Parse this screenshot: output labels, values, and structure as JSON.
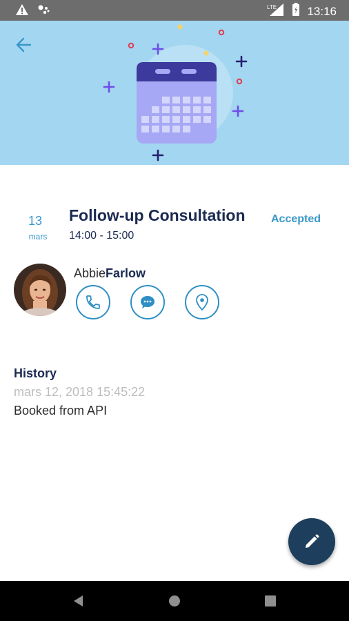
{
  "status_bar": {
    "time": "13:16",
    "network": "LTE",
    "icons": [
      "warning-icon",
      "assistant-icon",
      "signal-icon",
      "battery-icon"
    ]
  },
  "header": {
    "back_icon": "arrow-left-icon",
    "illustration": "calendar-icon",
    "background_color": "#a3d6f0"
  },
  "appointment": {
    "day": "13",
    "month": "mars",
    "title": "Follow-up Consultation",
    "time_range": "14:00 - 15:00",
    "status": "Accepted"
  },
  "client": {
    "first_name": "Abbie",
    "last_name": "Farlow",
    "actions": [
      "phone-icon",
      "chat-icon",
      "location-icon"
    ]
  },
  "history": {
    "title": "History",
    "date": "mars 12, 2018 15:45:22",
    "text": "Booked from API"
  },
  "fab": {
    "icon": "pencil-icon"
  },
  "colors": {
    "accent": "#3a97c9",
    "title": "#1b2a52",
    "fab": "#1d3e5c"
  }
}
